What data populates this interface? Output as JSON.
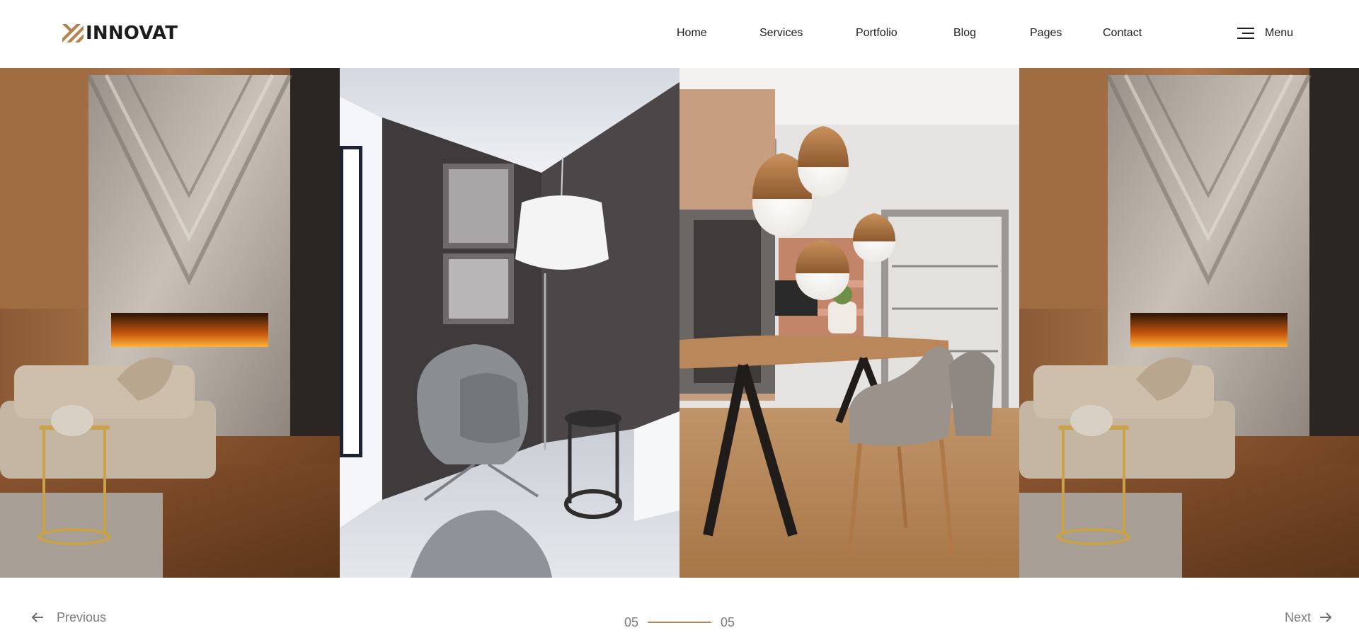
{
  "brand": {
    "name": "INNOVAT",
    "accent": "#b5844f"
  },
  "nav": {
    "items": [
      {
        "label": "Home"
      },
      {
        "label": "Services"
      },
      {
        "label": "Portfolio"
      },
      {
        "label": "Blog"
      },
      {
        "label": "Pages"
      },
      {
        "label": "Contact"
      }
    ],
    "menu_label": "Menu",
    "menu_icon": "hamburger-menu-icon"
  },
  "gallery": {
    "slides": [
      {
        "subject": "living room with marble fireplace wall"
      },
      {
        "subject": "grey armchair corner with pendant lamp"
      },
      {
        "subject": "dining room with wooden table and pendant lights"
      },
      {
        "subject": "living room with marble fireplace wall"
      }
    ]
  },
  "slider": {
    "previous_label": "Previous",
    "next_label": "Next",
    "current": "05",
    "total": "05",
    "prev_icon": "arrow-left-icon",
    "next_icon": "arrow-right-icon"
  }
}
